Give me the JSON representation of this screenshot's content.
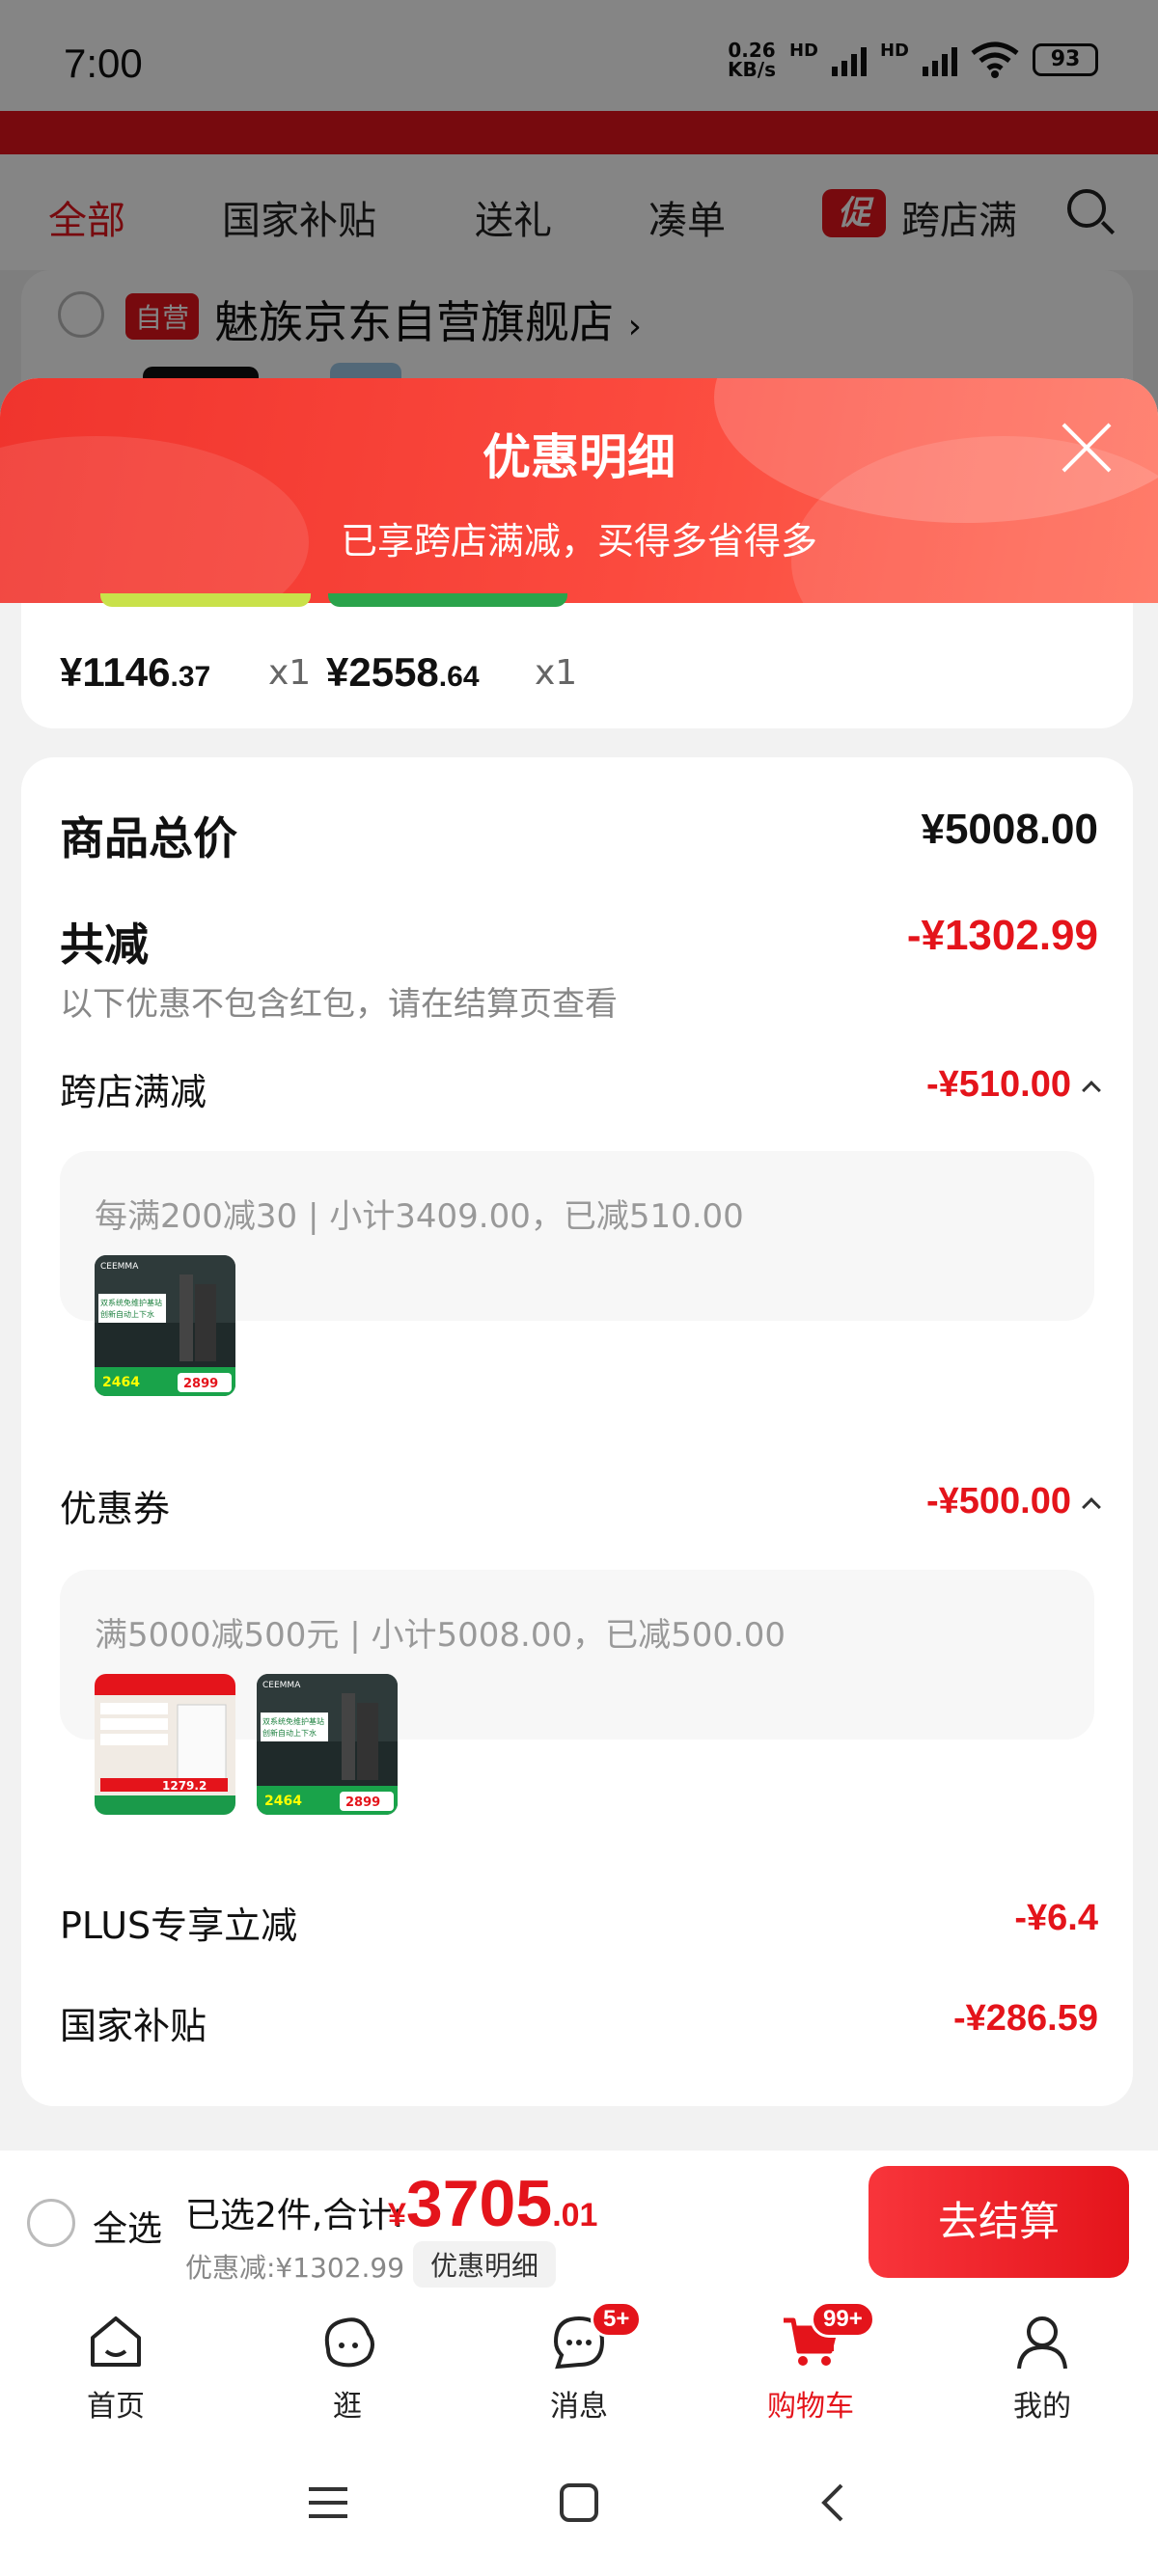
{
  "status_bar": {
    "time": "7:00",
    "net_speed_value": "0.26",
    "net_speed_unit": "KB/s",
    "hd1": "HD",
    "hd2": "HD",
    "battery": "93"
  },
  "tabs": [
    {
      "label": "全部",
      "active": true
    },
    {
      "label": "国家补贴"
    },
    {
      "label": "送礼"
    },
    {
      "label": "凑单"
    },
    {
      "label": "跨店满"
    }
  ],
  "promo_tag": "促",
  "store": {
    "tag": "自营",
    "name": "魅族京东自营旗舰店",
    "arrow": "›"
  },
  "sheet": {
    "title": "优惠明细",
    "subtitle": "已享跨店满减，买得多省得多"
  },
  "products": [
    {
      "price_int": "¥1146",
      "price_dec": ".37",
      "qty": "x1"
    },
    {
      "price_int": "¥2558",
      "price_dec": ".64",
      "qty": "x1"
    }
  ],
  "detail": {
    "total_label": "商品总价",
    "total_value": "¥5008.00",
    "reduce_label": "共减",
    "reduce_value": "-¥1302.99",
    "reduce_note": "以下优惠不包含红包，请在结算页查看",
    "cross_store": {
      "label": "跨店满减",
      "value": "-¥510.00",
      "rule": "每满200减30 | 小计3409.00，已减510.00"
    },
    "coupon": {
      "label": "优惠券",
      "value": "-¥500.00",
      "rule": "满5000减500元 | 小计5008.00，已减500.00"
    },
    "plus": {
      "label": "PLUS专享立减",
      "value": "-¥6.4"
    },
    "national": {
      "label": "国家补贴",
      "value": "-¥286.59"
    }
  },
  "thumbs": {
    "vacuum": {
      "brand": "CEEMMA",
      "line1": "双系统免维护基站",
      "line2": "创新自动上下水",
      "price_a": "2464",
      "price_b": "2899"
    },
    "appliance": {
      "price": "1279.2"
    }
  },
  "checkout": {
    "select_all": "全选",
    "selected": "已选2件,合计:",
    "yen": "¥",
    "total_int": "3705",
    "total_dec": ".01",
    "discount": "优惠减:¥1302.99",
    "detail_btn": "优惠明细",
    "pay_btn": "去结算"
  },
  "nav": [
    {
      "label": "首页",
      "icon": "home-icon"
    },
    {
      "label": "逛",
      "icon": "browse-icon"
    },
    {
      "label": "消息",
      "icon": "message-icon",
      "badge": "5+"
    },
    {
      "label": "购物车",
      "icon": "cart-icon",
      "badge": "99+",
      "active": true
    },
    {
      "label": "我的",
      "icon": "profile-icon"
    }
  ],
  "colors": {
    "accent": "#e4141b",
    "header_gradient_start": "#f0342d",
    "header_gradient_end": "#ff6a56"
  }
}
